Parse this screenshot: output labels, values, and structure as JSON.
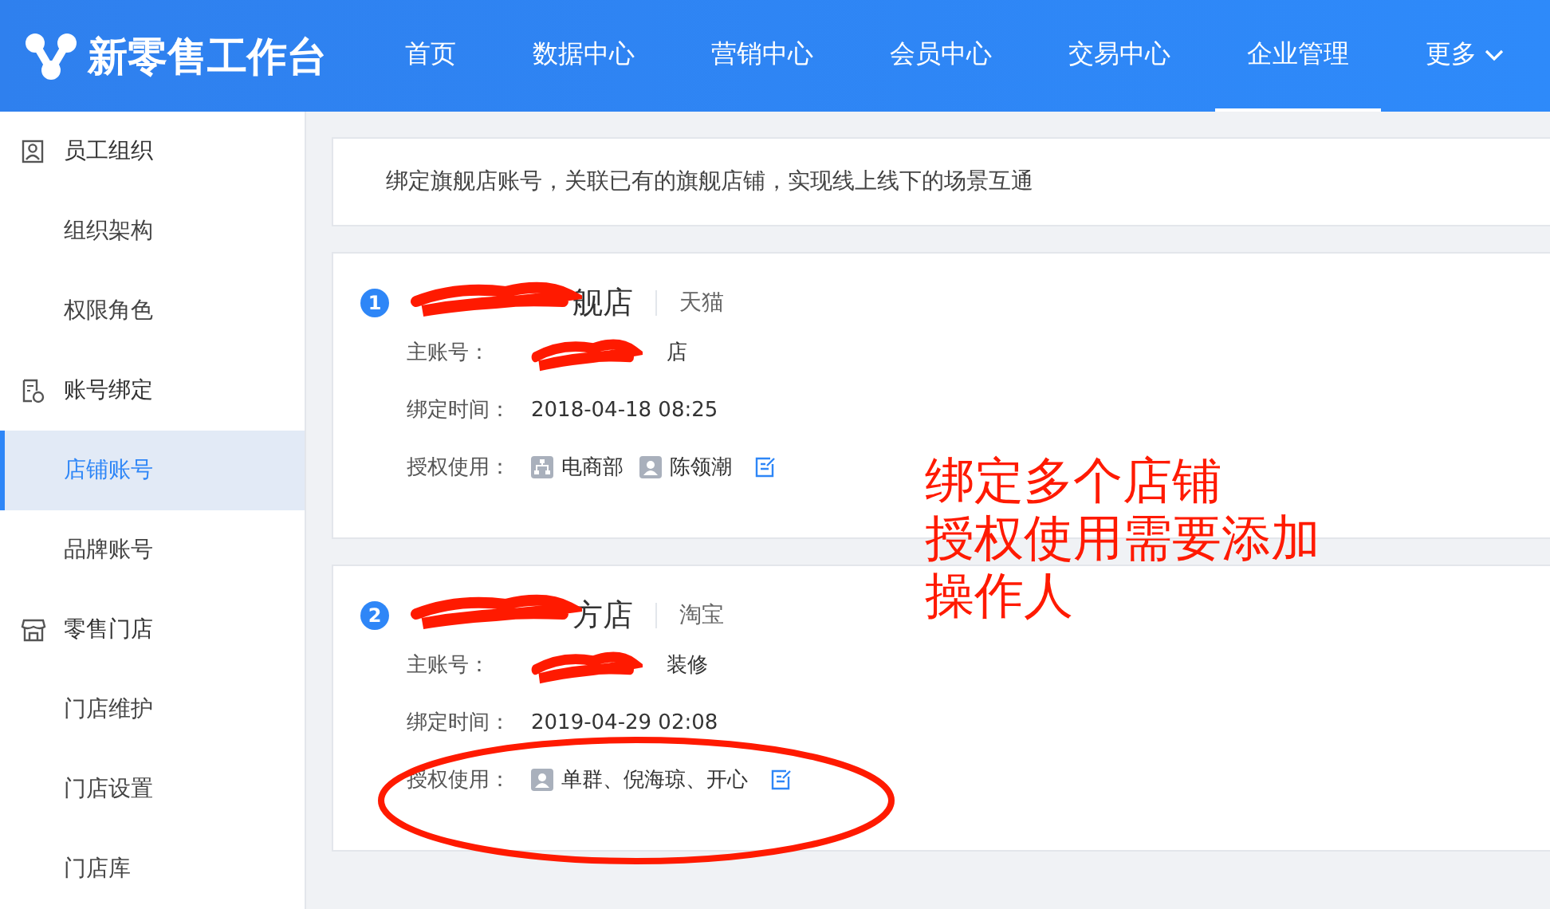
{
  "header": {
    "logo": "新零售工作台",
    "nav": [
      {
        "label": "首页",
        "selected": false
      },
      {
        "label": "数据中心",
        "selected": false
      },
      {
        "label": "营销中心",
        "selected": false
      },
      {
        "label": "会员中心",
        "selected": false
      },
      {
        "label": "交易中心",
        "selected": false
      },
      {
        "label": "企业管理",
        "selected": true
      }
    ],
    "more": "更多"
  },
  "sidebar": [
    {
      "label": "员工组织",
      "children": [
        {
          "label": "组织架构",
          "selected": false
        },
        {
          "label": "权限角色",
          "selected": false
        }
      ]
    },
    {
      "label": "账号绑定",
      "children": [
        {
          "label": "店铺账号",
          "selected": true
        },
        {
          "label": "品牌账号",
          "selected": false
        }
      ]
    },
    {
      "label": "零售门店",
      "children": [
        {
          "label": "门店维护",
          "selected": false
        },
        {
          "label": "门店设置",
          "selected": false
        },
        {
          "label": "门店库",
          "selected": false
        }
      ]
    }
  ],
  "banner": "绑定旗舰店账号，关联已有的旗舰店铺，实现线上线下的场景互通",
  "stores": [
    {
      "number": "1",
      "name": "舰店",
      "redacted": true,
      "platform": "天猫",
      "fields": [
        {
          "label": "主账号：",
          "value": "店",
          "redacted": true
        },
        {
          "label": "绑定时间：",
          "value": "2018-04-18 08:25"
        }
      ],
      "auth": {
        "label": "授权使用：",
        "items": [
          {
            "kind": "dept",
            "text": "电商部"
          },
          {
            "kind": "person",
            "text": "陈领潮"
          }
        ]
      }
    },
    {
      "number": "2",
      "name": "方店",
      "redacted": true,
      "platform": "淘宝",
      "fields": [
        {
          "label": "主账号：",
          "value": "装修",
          "redacted": true
        },
        {
          "label": "绑定时间：",
          "value": "2019-04-29 02:08"
        }
      ],
      "auth": {
        "label": "授权使用：",
        "items": [
          {
            "kind": "person",
            "text": "单群、倪海琼、开心"
          }
        ]
      },
      "circled": true
    }
  ],
  "annotation": [
    "绑定多个店铺",
    "授权使用需要添加",
    "操作人"
  ]
}
